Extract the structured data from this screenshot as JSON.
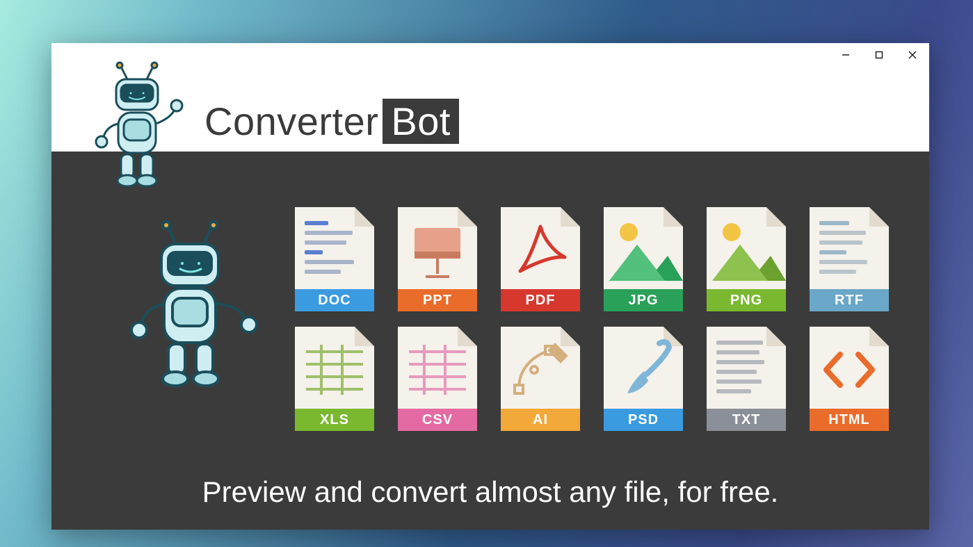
{
  "app": {
    "title_part1": "Converter",
    "title_part2": "Bot",
    "tagline": "Preview and convert almost any file, for free."
  },
  "window_controls": {
    "minimize": "minimize",
    "maximize": "maximize",
    "close": "close"
  },
  "files": [
    {
      "label": "DOC",
      "color": "#3b9be0",
      "icon": "doc"
    },
    {
      "label": "PPT",
      "color": "#e96c2b",
      "icon": "ppt"
    },
    {
      "label": "PDF",
      "color": "#d6382e",
      "icon": "pdf"
    },
    {
      "label": "JPG",
      "color": "#2aa159",
      "icon": "jpg"
    },
    {
      "label": "PNG",
      "color": "#7ab92f",
      "icon": "png"
    },
    {
      "label": "RTF",
      "color": "#6aa7c8",
      "icon": "rtf"
    },
    {
      "label": "XLS",
      "color": "#7ab92f",
      "icon": "xls"
    },
    {
      "label": "CSV",
      "color": "#e36aa2",
      "icon": "csv"
    },
    {
      "label": "AI",
      "color": "#f2a93a",
      "icon": "ai"
    },
    {
      "label": "PSD",
      "color": "#3b9be0",
      "icon": "psd"
    },
    {
      "label": "TXT",
      "color": "#8a8f98",
      "icon": "txt"
    },
    {
      "label": "HTML",
      "color": "#e96c2b",
      "icon": "html"
    }
  ]
}
